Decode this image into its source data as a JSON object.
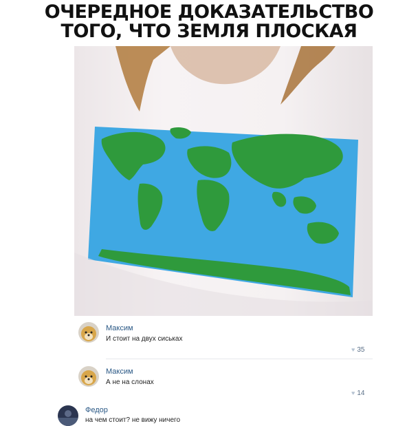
{
  "headline": {
    "line1": "ОЧЕРЕДНОЕ ДОКАЗАТЕЛЬСТВО",
    "line2": "ТОГО, ЧТО ЗЕМЛЯ ПЛОСКАЯ"
  },
  "photo": {
    "map_colors": {
      "ocean": "#3fa8e3",
      "land": "#2f9a3c",
      "shirt": "#f3eff0",
      "hair": "#b07a3c"
    }
  },
  "comments": [
    {
      "author": "Максим",
      "text": "И стоит на двух сиськах",
      "likes": "35"
    },
    {
      "author": "Максим",
      "text": "А не на слонах",
      "likes": "14"
    },
    {
      "author": "Федор",
      "text": "на чем стоит? не вижу ничего"
    }
  ],
  "accent_colors": {
    "author_link": "#2a5885",
    "like_count": "#5a6f87"
  }
}
